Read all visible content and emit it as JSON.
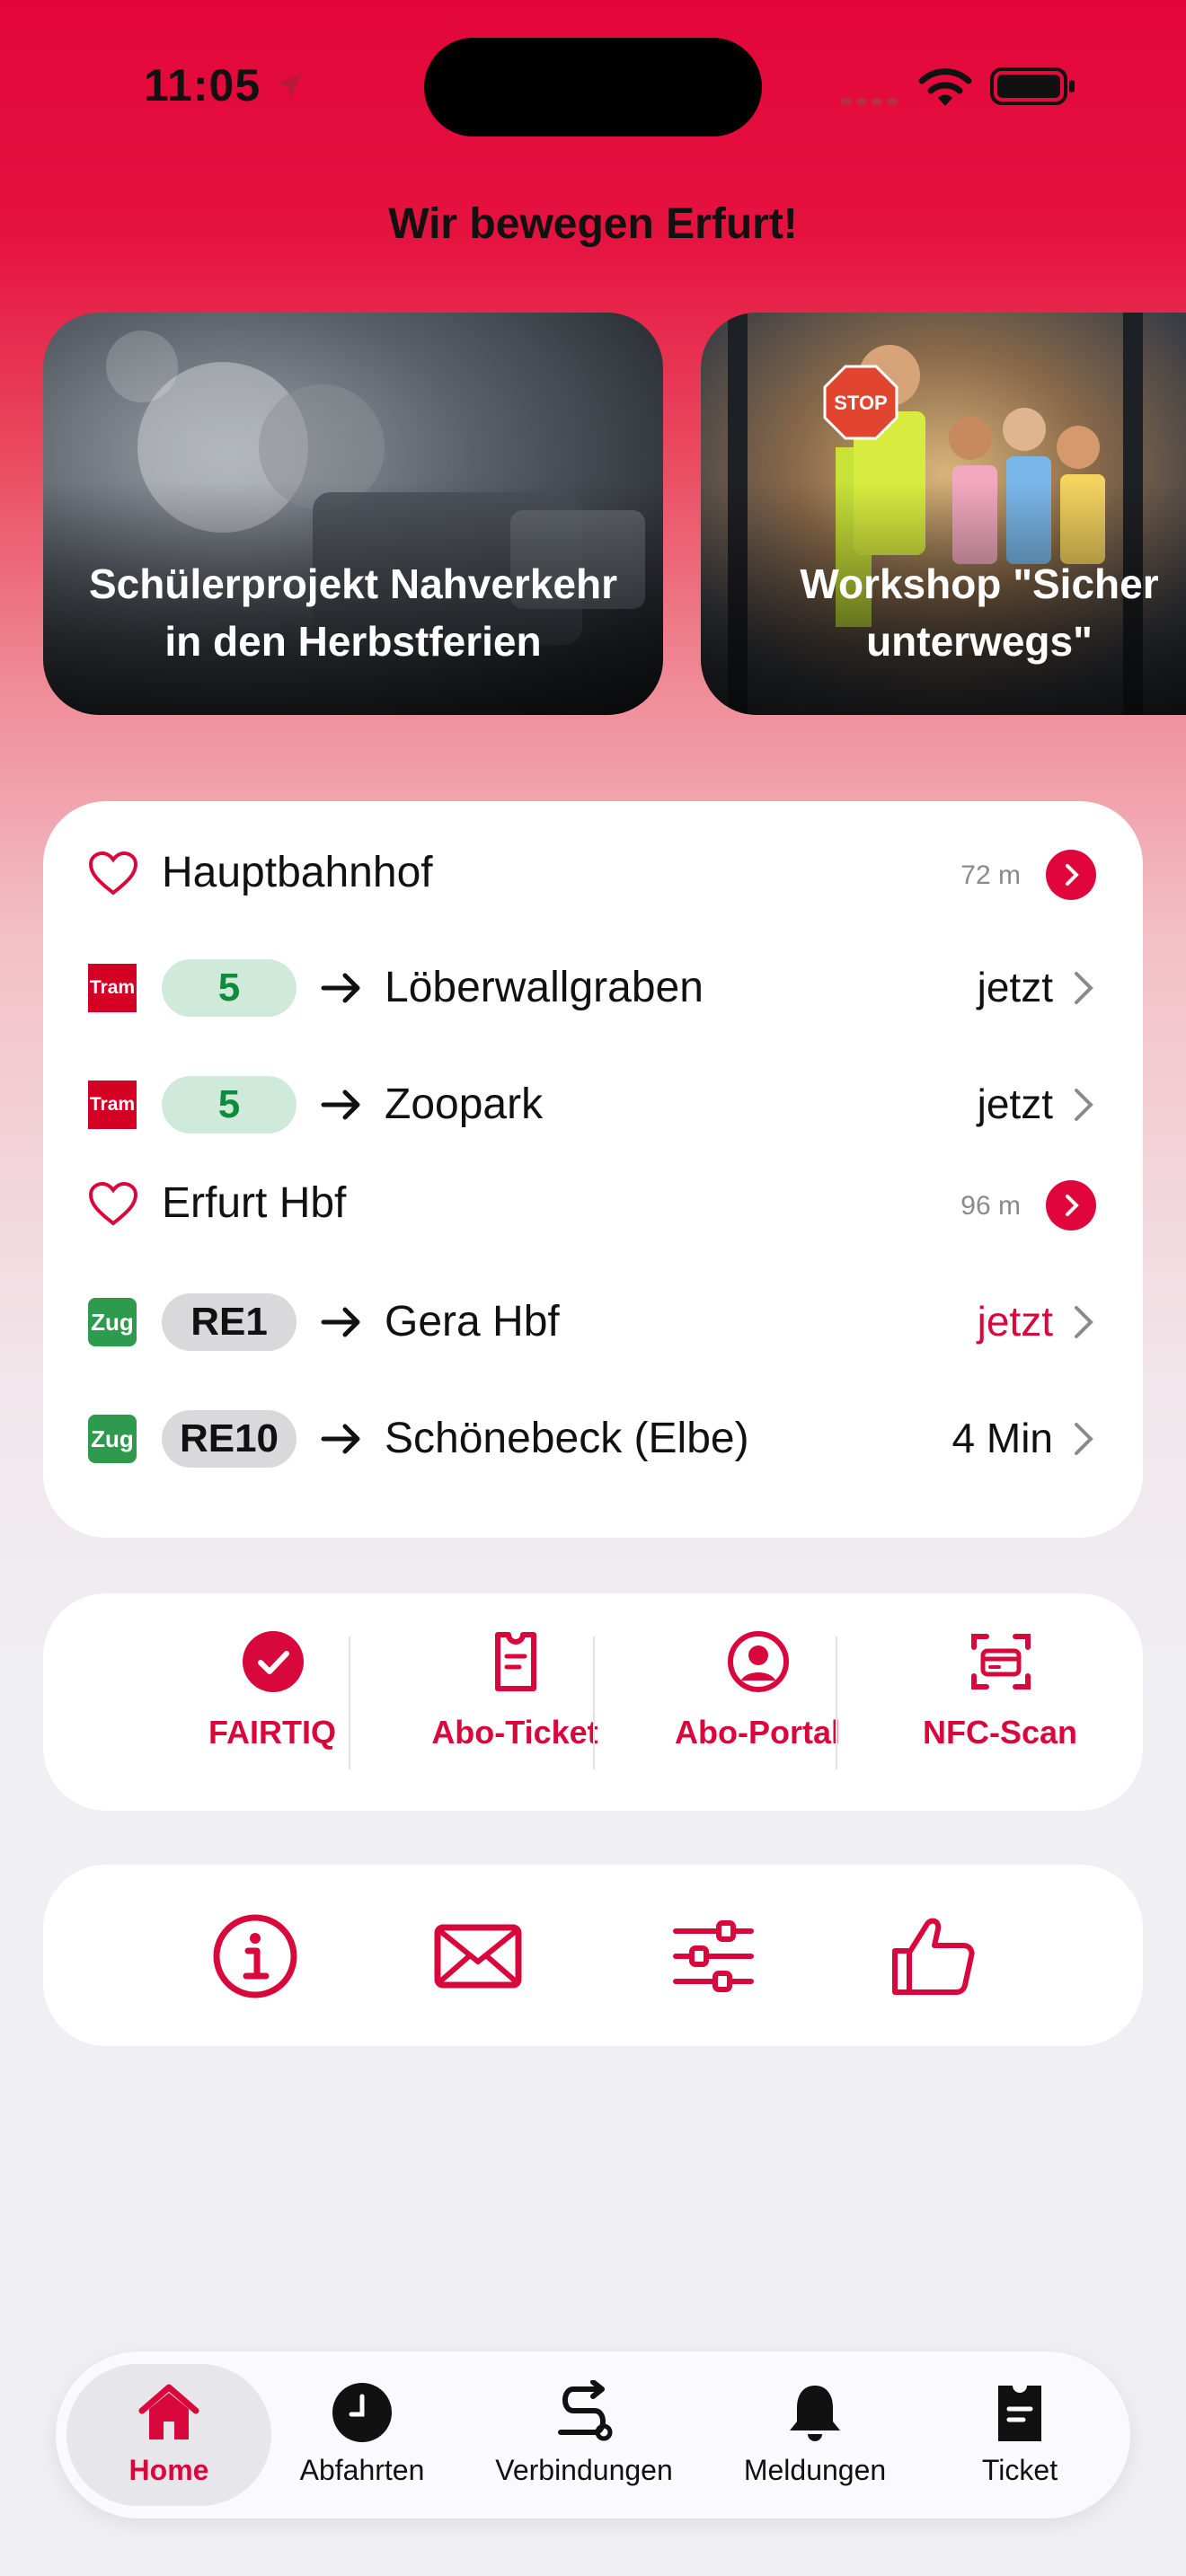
{
  "status_bar": {
    "time": "11:05"
  },
  "headline": "Wir bewegen Erfurt!",
  "news": [
    {
      "title_line1": "Schülerprojekt Nahverkehr",
      "title_line2": "in den Herbstferien"
    },
    {
      "title_line1": "Workshop \"Sicher",
      "title_line2": "unterwegs\"",
      "sign_text": "STOP"
    }
  ],
  "favorites": [
    {
      "stop": "Hauptbahnhof",
      "distance": "72 m",
      "departures": [
        {
          "mode": "Tram",
          "line": "5",
          "destination": "Löberwallgraben",
          "time": "jetzt",
          "time_color": "#111111"
        },
        {
          "mode": "Tram",
          "line": "5",
          "destination": "Zoopark",
          "time": "jetzt",
          "time_color": "#111111"
        }
      ]
    },
    {
      "stop": "Erfurt Hbf",
      "distance": "96 m",
      "departures": [
        {
          "mode": "Zug",
          "line": "RE1",
          "destination": "Gera Hbf",
          "time": "jetzt",
          "time_color": "#d9083c"
        },
        {
          "mode": "Zug",
          "line": "RE10",
          "destination": "Schönebeck (Elbe)",
          "time": "4 Min",
          "time_color": "#111111"
        }
      ]
    }
  ],
  "quick_actions": [
    {
      "label": "FAIRTIQ",
      "icon": "check-circle-icon"
    },
    {
      "label": "Abo-Ticket",
      "icon": "ticket-icon"
    },
    {
      "label": "Abo-Portal",
      "icon": "user-circle-icon"
    },
    {
      "label": "NFC-Scan",
      "icon": "nfc-scan-icon"
    }
  ],
  "tools": [
    {
      "icon": "info-icon"
    },
    {
      "icon": "mail-icon"
    },
    {
      "icon": "settings-sliders-icon"
    },
    {
      "icon": "thumbs-up-icon"
    }
  ],
  "tabs": [
    {
      "label": "Home",
      "icon": "home-icon",
      "active": true
    },
    {
      "label": "Abfahrten",
      "icon": "clock-icon",
      "active": false
    },
    {
      "label": "Verbindungen",
      "icon": "route-icon",
      "active": false
    },
    {
      "label": "Meldungen",
      "icon": "bell-icon",
      "active": false
    },
    {
      "label": "Ticket",
      "icon": "ticket-icon",
      "active": false
    }
  ],
  "colors": {
    "brand_red": "#e0063b",
    "tram_line_bg": "#cfeadb",
    "tram_line_text": "#128a3c",
    "train_line_bg": "#d9d9dc",
    "train_badge": "#2e9a4e",
    "tram_badge": "#d40023"
  }
}
